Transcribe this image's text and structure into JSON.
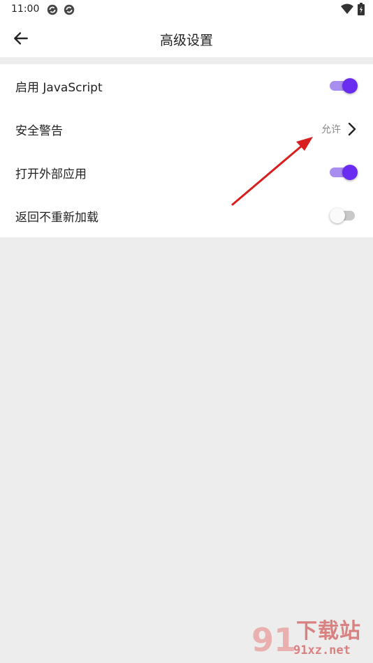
{
  "status_bar": {
    "time": "11:00",
    "left_icons": [
      "sync-icon",
      "sync-icon"
    ],
    "right_icons": [
      "wifi-icon",
      "battery-charging-icon"
    ]
  },
  "app_bar": {
    "title": "高级设置",
    "back_icon": "arrow-left-icon"
  },
  "settings": {
    "javascript": {
      "label": "启用 JavaScript",
      "enabled": true
    },
    "security_warning": {
      "label": "安全警告",
      "value": "允许"
    },
    "open_external": {
      "label": "打开外部应用",
      "enabled": true
    },
    "no_reload_on_back": {
      "label": "返回不重新加载",
      "enabled": false
    }
  },
  "colors": {
    "accent": "#6a2cf0",
    "accent_track": "#a98ef0",
    "annotation_arrow": "#d81e1e"
  },
  "watermark": {
    "title": "下载站",
    "url": "91xz.net"
  }
}
